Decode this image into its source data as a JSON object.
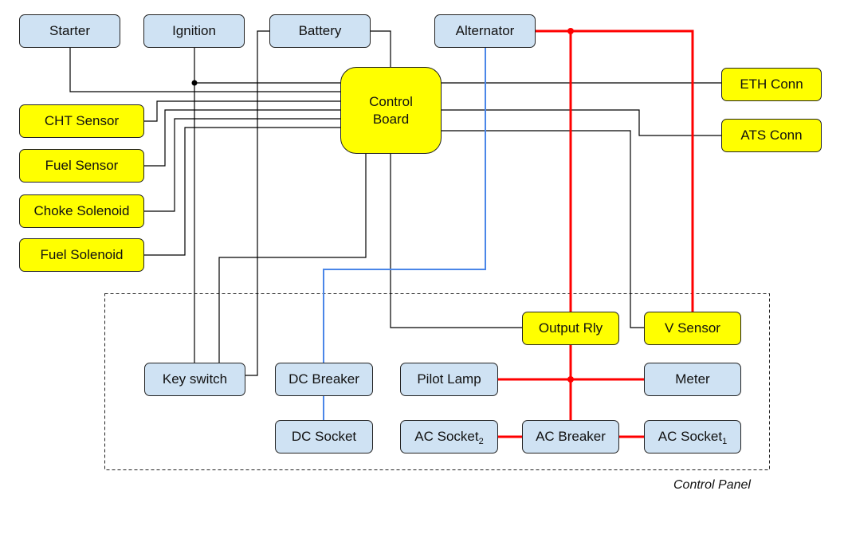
{
  "colors": {
    "control_node": "#ffff00",
    "component_node": "#cfe2f3",
    "ac_power_wire": "#ff0000",
    "dc_power_wire": "#4a86e8",
    "signal_wire": "#000000"
  },
  "nodes": {
    "starter": {
      "label": "Starter"
    },
    "ignition": {
      "label": "Ignition"
    },
    "battery": {
      "label": "Battery"
    },
    "alternator": {
      "label": "Alternator"
    },
    "control_board": {
      "label_line1": "Control",
      "label_line2": "Board"
    },
    "eth_conn": {
      "label": "ETH Conn"
    },
    "ats_conn": {
      "label": "ATS Conn"
    },
    "cht_sensor": {
      "label": "CHT Sensor"
    },
    "fuel_sensor": {
      "label": "Fuel Sensor"
    },
    "choke_solenoid": {
      "label": "Choke Solenoid"
    },
    "fuel_solenoid": {
      "label": "Fuel Solenoid"
    },
    "output_rly": {
      "label": "Output Rly"
    },
    "v_sensor": {
      "label": "V Sensor"
    },
    "key_switch": {
      "label": "Key switch"
    },
    "dc_breaker": {
      "label": "DC Breaker"
    },
    "pilot_lamp": {
      "label": "Pilot Lamp"
    },
    "meter": {
      "label": "Meter"
    },
    "dc_socket": {
      "label": "DC Socket"
    },
    "ac_socket_2": {
      "label": "AC Socket",
      "subscript": "2"
    },
    "ac_breaker": {
      "label": "AC Breaker"
    },
    "ac_socket_1": {
      "label": "AC Socket",
      "subscript": "1"
    }
  },
  "group": {
    "label": "Control Panel"
  }
}
